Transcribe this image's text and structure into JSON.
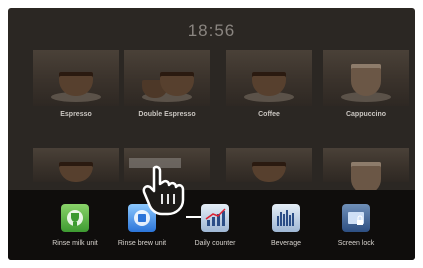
{
  "clock": "18:56",
  "beverages": [
    {
      "label": "Espresso"
    },
    {
      "label": "Double Espresso"
    },
    {
      "label": "Coffee"
    },
    {
      "label": "Cappuccino"
    }
  ],
  "toolbar": [
    {
      "label": "Rinse milk unit",
      "icon": "rinse-milk-icon"
    },
    {
      "label": "Rinse brew unit",
      "icon": "rinse-brew-icon"
    },
    {
      "label": "Daily counter",
      "icon": "daily-counter-icon"
    },
    {
      "label": "Beverage",
      "icon": "beverage-counter-icon"
    },
    {
      "label": "Screen lock",
      "icon": "screen-lock-icon"
    }
  ]
}
